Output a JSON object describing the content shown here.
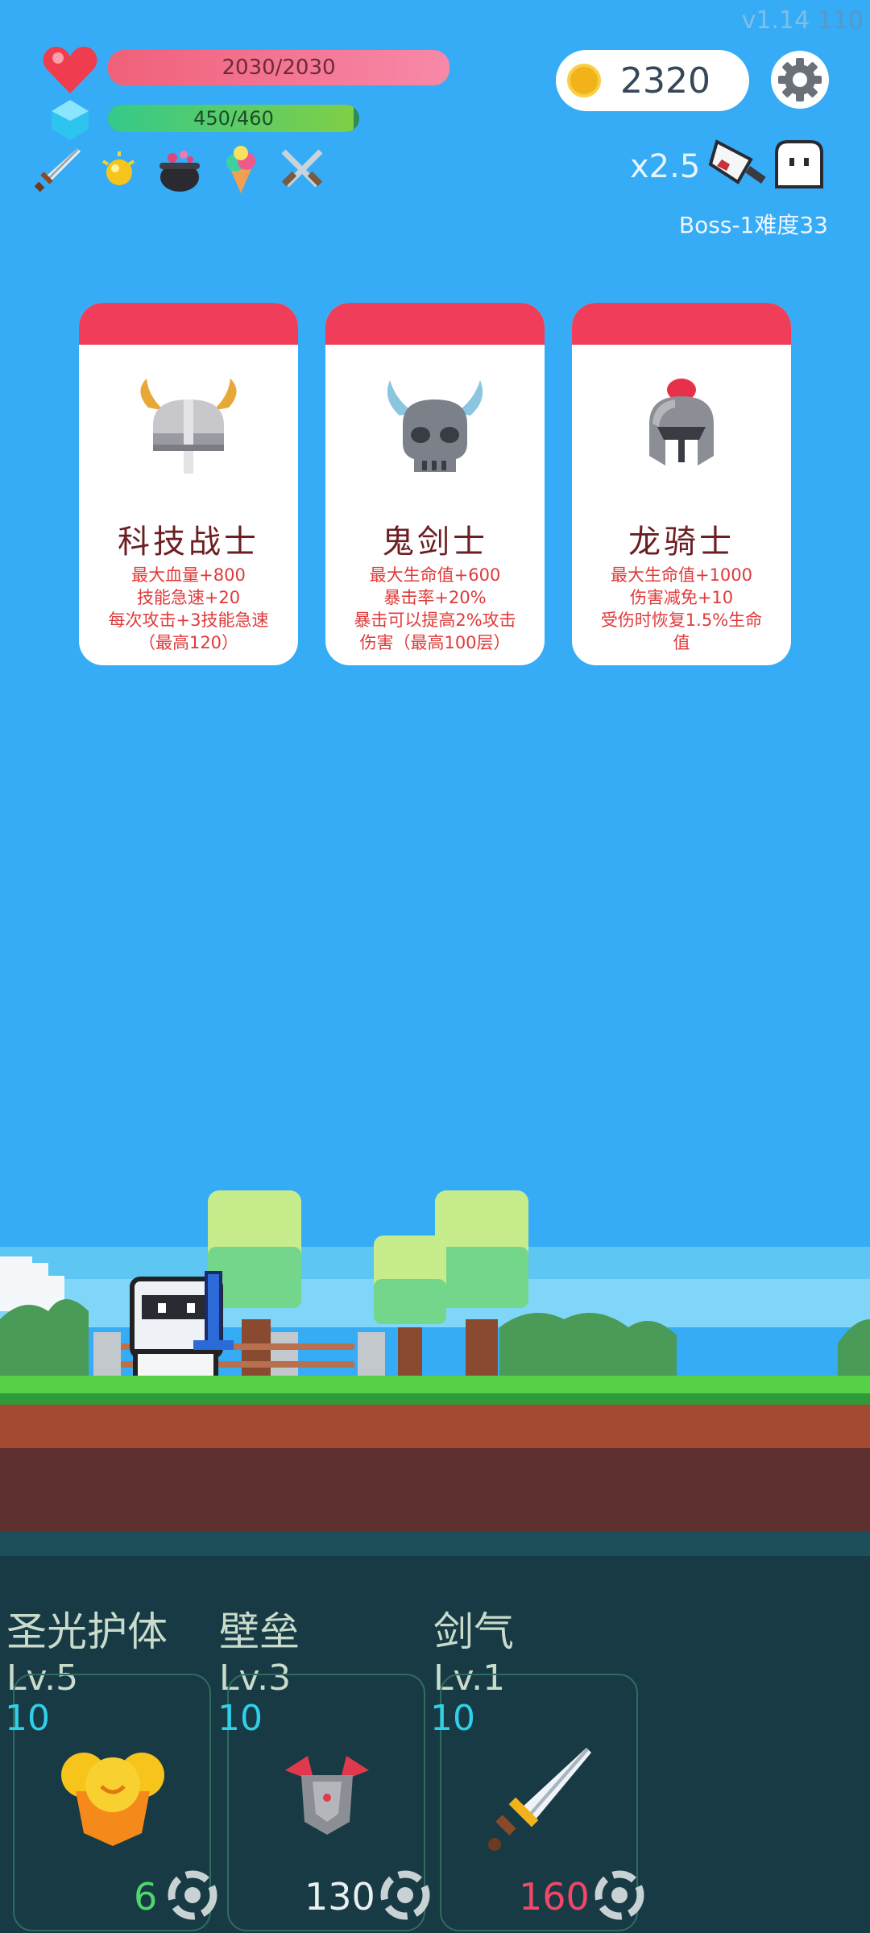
{
  "version": {
    "label": "v1.14",
    "build": "110"
  },
  "hp": {
    "text": "2030/2030",
    "fill": 1.0
  },
  "mp": {
    "text": "450/460",
    "fill": 0.978
  },
  "coins": {
    "value": "2320"
  },
  "items": [
    "sword-icon",
    "sun-orb-icon",
    "cauldron-icon",
    "ice-cream-icon",
    "crossed-swords-icon"
  ],
  "speed": {
    "label": "x2.5"
  },
  "boss": {
    "label": "Boss-1难度33"
  },
  "cards": [
    {
      "name": "科技战士",
      "desc": [
        "最大血量+800",
        "技能急速+20",
        "每次攻击+3技能急速",
        "（最高120）"
      ],
      "icon": "viking-helmet-icon"
    },
    {
      "name": "鬼剑士",
      "desc": [
        "最大生命值+600",
        "暴击率+20%",
        "暴击可以提高2%攻击",
        "伤害（最高100层）"
      ],
      "icon": "skull-helmet-icon"
    },
    {
      "name": "龙骑士",
      "desc": [
        "最大生命值+1000",
        "伤害减免+10",
        "受伤时恢复1.5%生命",
        "值"
      ],
      "icon": "knight-helmet-icon"
    }
  ],
  "skills": [
    {
      "name": "圣光护体",
      "level": "Lv.5",
      "cost": "10",
      "count": "6",
      "count_color": "#4fd86a",
      "icon": "holy-shield-icon"
    },
    {
      "name": "壁垒",
      "level": "Lv.3",
      "cost": "10",
      "count": "130",
      "count_color": "#e8f0f0",
      "icon": "armor-icon"
    },
    {
      "name": "剑气",
      "level": "Lv.1",
      "cost": "10",
      "count": "160",
      "count_color": "#f0476a",
      "icon": "sword-icon"
    }
  ]
}
